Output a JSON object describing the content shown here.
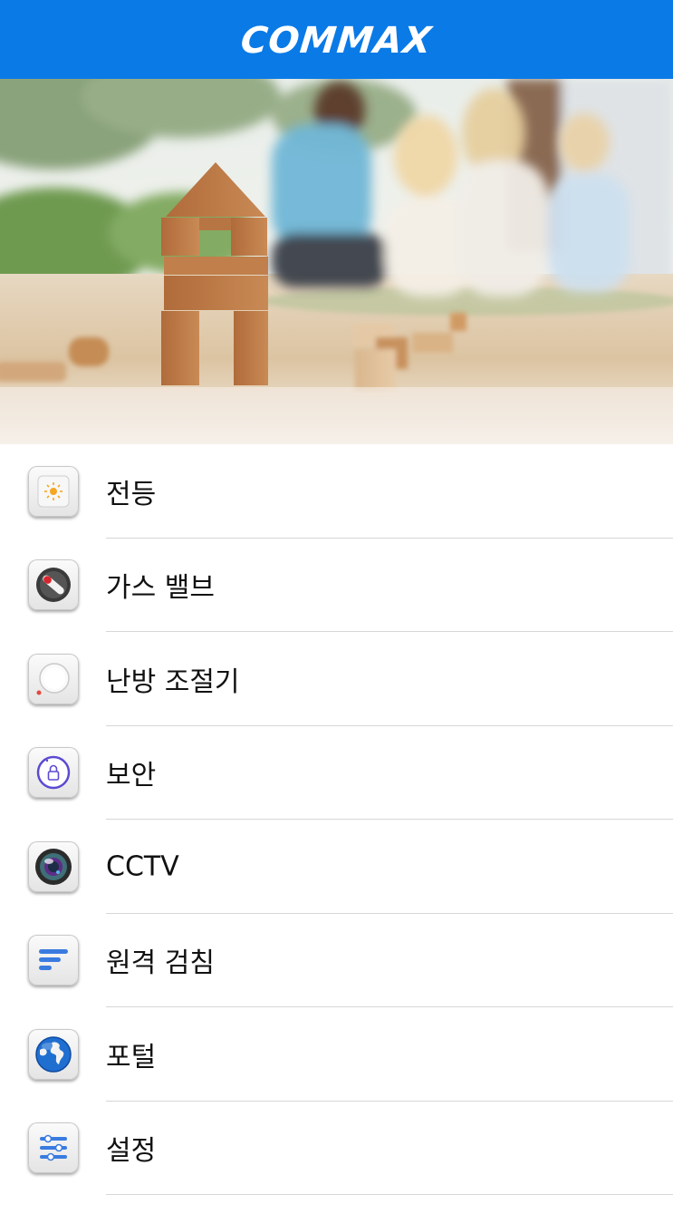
{
  "header": {
    "logo_text": "COMMAX",
    "background_color": "#0a7ae6"
  },
  "hero": {
    "description_icon": "family-photo-with-wooden-block-house"
  },
  "menu": {
    "items": [
      {
        "label": "전등",
        "icon": "light-icon"
      },
      {
        "label": "가스 밸브",
        "icon": "gas-valve-icon"
      },
      {
        "label": "난방 조절기",
        "icon": "thermostat-icon"
      },
      {
        "label": "보안",
        "icon": "security-lock-icon"
      },
      {
        "label": "CCTV",
        "icon": "camera-icon"
      },
      {
        "label": "원격 검침",
        "icon": "remote-meter-icon"
      },
      {
        "label": "포털",
        "icon": "globe-icon"
      },
      {
        "label": "설정",
        "icon": "settings-sliders-icon"
      }
    ]
  }
}
